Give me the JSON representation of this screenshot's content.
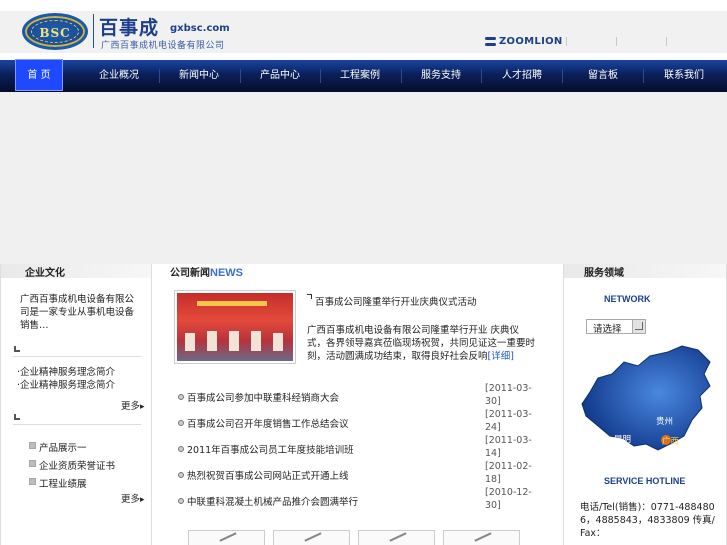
{
  "header": {
    "logo_text": "BSC",
    "brand_cn": "百事成",
    "brand_domain": "gxbsc.com",
    "brand_sub": "广西百事成机电设备有限公司",
    "partner_logo": "ZOOMLION"
  },
  "nav": {
    "items": [
      {
        "label": "首 页",
        "active": true
      },
      {
        "label": "企业概况"
      },
      {
        "label": "新闻中心"
      },
      {
        "label": "产品中心"
      },
      {
        "label": "工程案例"
      },
      {
        "label": "服务支持"
      },
      {
        "label": "人才招聘"
      },
      {
        "label": "留言板"
      },
      {
        "label": "联系我们"
      }
    ]
  },
  "left": {
    "title": "企业文化",
    "culture_text": "广西百事成机电设备有限公司是一家专业从事机电设备销售…",
    "links1": [
      "·企业精神服务理念简介",
      "·企业精神服务理念简介"
    ],
    "more1": "更多",
    "links2": [
      "产品展示一",
      "企业资质荣誉证书",
      "工程业绩展"
    ],
    "more2": "更多"
  },
  "news": {
    "title_cn": "公司新闻",
    "title_en": "NEWS",
    "headline": "百事成公司隆重举行开业庆典仪式活动",
    "summary": "广西百事成机电设备有限公司隆重举行开业 庆典仪式，各界领导嘉宾莅临现场祝贺，共同见证这一重要时刻，活动圆满成功结束，取得良好社会反响",
    "summary_link": "[详细]",
    "rows": [
      {
        "text": "百事成公司参加中联重科经销商大会",
        "date": "[2011-03-30]"
      },
      {
        "text": "百事成公司召开年度销售工作总结会议",
        "date": "[2011-03-24]"
      },
      {
        "text": "2011年百事成公司员工年度技能培训班",
        "date": "[2011-03-14]"
      },
      {
        "text": "热烈祝贺百事成公司网站正式开通上线",
        "date": "[2011-02-18]"
      },
      {
        "text": "中联重科混凝土机械产品推介会圆满举行",
        "date": "[2010-12-30]"
      }
    ]
  },
  "right": {
    "title": "服务领域",
    "network_label": "NETWORK",
    "select_value": "请选择",
    "map_labels": [
      "贵州",
      "昆明",
      "广西"
    ],
    "hotline_label": "SERVICE HOTLINE",
    "contact_text": "电话/Tel(销售)：0771-4884806，4885843，4833809 传真/Fax："
  }
}
